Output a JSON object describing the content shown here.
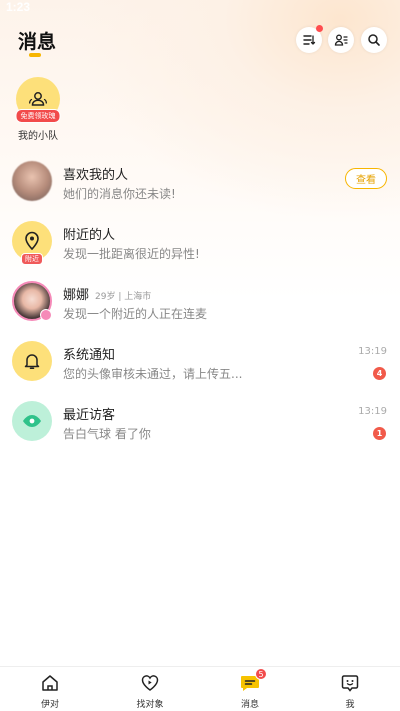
{
  "status_bar": {
    "time": "1:23"
  },
  "header": {
    "title": "消息",
    "icons": [
      "sort-list-icon",
      "contacts-icon",
      "search-icon"
    ]
  },
  "team": {
    "badge": "免费领玫瑰",
    "label": "我的小队",
    "icon": "team-icon"
  },
  "conversations": [
    {
      "title": "喜欢我的人",
      "subtitle": "她们的消息你还未读!",
      "action": "查看",
      "icon": "blurred-avatar"
    },
    {
      "title": "附近的人",
      "subtitle": "发现一批距离很近的异性!",
      "tag": "附近",
      "icon": "location-pin-icon"
    },
    {
      "title": "娜娜",
      "meta": "29岁 | 上海市",
      "subtitle": "发现一个附近的人正在连麦",
      "icon": "user-avatar"
    },
    {
      "title": "系统通知",
      "subtitle": "您的头像审核未通过，请上传五...",
      "time": "13:19",
      "count": "4",
      "icon": "bell-icon"
    },
    {
      "title": "最近访客",
      "subtitle": "告白气球 看了你",
      "time": "13:19",
      "count": "1",
      "icon": "eye-icon"
    }
  ],
  "tabbar": {
    "items": [
      {
        "label": "伊对",
        "icon": "home-icon"
      },
      {
        "label": "找对象",
        "icon": "heart-play-icon"
      },
      {
        "label": "消息",
        "icon": "message-icon",
        "badge": "5"
      },
      {
        "label": "我",
        "icon": "profile-icon"
      }
    ]
  },
  "colors": {
    "accent": "#f7b500",
    "badge": "#f24b4b"
  }
}
